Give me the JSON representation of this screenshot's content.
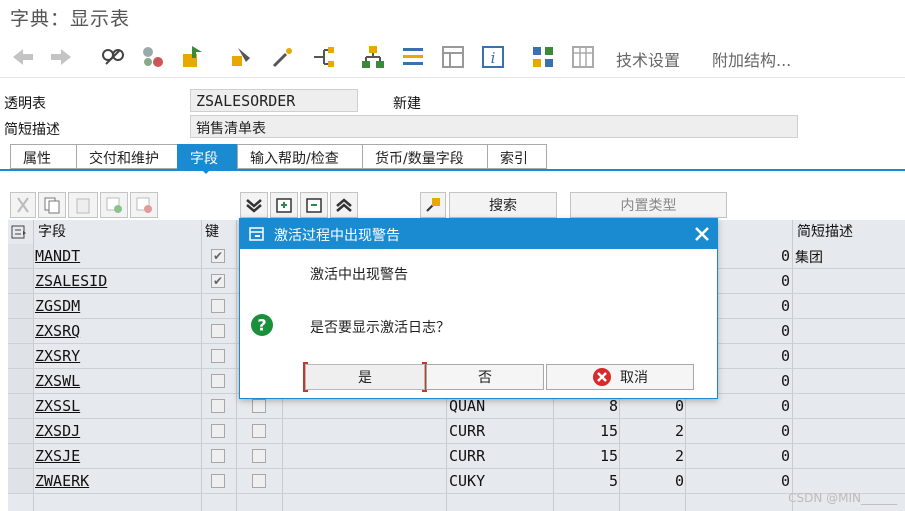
{
  "window": {
    "title": "字典：显示表"
  },
  "toolbar": {
    "icons": [
      "back-arrow-icon",
      "forward-arrow-icon",
      "display-change-icon",
      "other-object-icon",
      "activate-icon",
      "check-icon",
      "magic-wand-icon",
      "where-used-icon",
      "hierarchy-icon",
      "object-list-icon",
      "navigation-window-icon",
      "info-icon",
      "layout-icon",
      "grid-icon"
    ],
    "tech_settings": "技术设置",
    "append_structure": "附加结构..."
  },
  "header": {
    "transparent_table_label": "透明表",
    "table_name": "ZSALESORDER",
    "status": "新建",
    "short_desc_label": "简短描述",
    "short_desc_value": "销售清单表"
  },
  "tabs": [
    {
      "label": "属性",
      "active": false
    },
    {
      "label": "交付和维护",
      "active": false
    },
    {
      "label": "字段",
      "active": true
    },
    {
      "label": "输入帮助/检查",
      "active": false
    },
    {
      "label": "货币/数量字段",
      "active": false
    },
    {
      "label": "索引",
      "active": false
    }
  ],
  "table_toolbar": {
    "search_label": "搜索",
    "builtin_type_label": "内置类型"
  },
  "grid": {
    "headers": {
      "field": "字段",
      "key": "键",
      "short_desc": "简短描述"
    },
    "rows": [
      {
        "field": "MANDT",
        "key": true,
        "type": "",
        "len": "",
        "dec": "",
        "col5": "0",
        "desc": "集团"
      },
      {
        "field": "ZSALESID",
        "key": true,
        "type": "",
        "len": "",
        "dec": "",
        "col5": "0",
        "desc": ""
      },
      {
        "field": "ZGSDM",
        "key": false,
        "type": "",
        "len": "",
        "dec": "",
        "col5": "0",
        "desc": ""
      },
      {
        "field": "ZXSRQ",
        "key": false,
        "type": "",
        "len": "",
        "dec": "",
        "col5": "0",
        "desc": ""
      },
      {
        "field": "ZXSRY",
        "key": false,
        "type": "",
        "len": "",
        "dec": "",
        "col5": "0",
        "desc": ""
      },
      {
        "field": "ZXSWL",
        "key": false,
        "type": "",
        "len": "",
        "dec": "",
        "col5": "0",
        "desc": ""
      },
      {
        "field": "ZXSSL",
        "key": false,
        "type": "QUAN",
        "len": "8",
        "dec": "0",
        "col5": "0",
        "desc": ""
      },
      {
        "field": "ZXSDJ",
        "key": false,
        "type": "CURR",
        "len": "15",
        "dec": "2",
        "col5": "0",
        "desc": ""
      },
      {
        "field": "ZXSJE",
        "key": false,
        "type": "CURR",
        "len": "15",
        "dec": "2",
        "col5": "0",
        "desc": ""
      },
      {
        "field": "ZWAERK",
        "key": false,
        "type": "CUKY",
        "len": "5",
        "dec": "0",
        "col5": "0",
        "desc": ""
      }
    ]
  },
  "dialog": {
    "title": "激活过程中出现警告",
    "line1": "激活中出现警告",
    "question": "是否要显示激活日志？",
    "yes": "是",
    "no": "否",
    "cancel": "取消"
  },
  "watermark": "CSDN @MIN______",
  "colors": {
    "accent": "#1b8bd1",
    "question": "#1a8f3c",
    "cancel": "#d62b2b"
  }
}
